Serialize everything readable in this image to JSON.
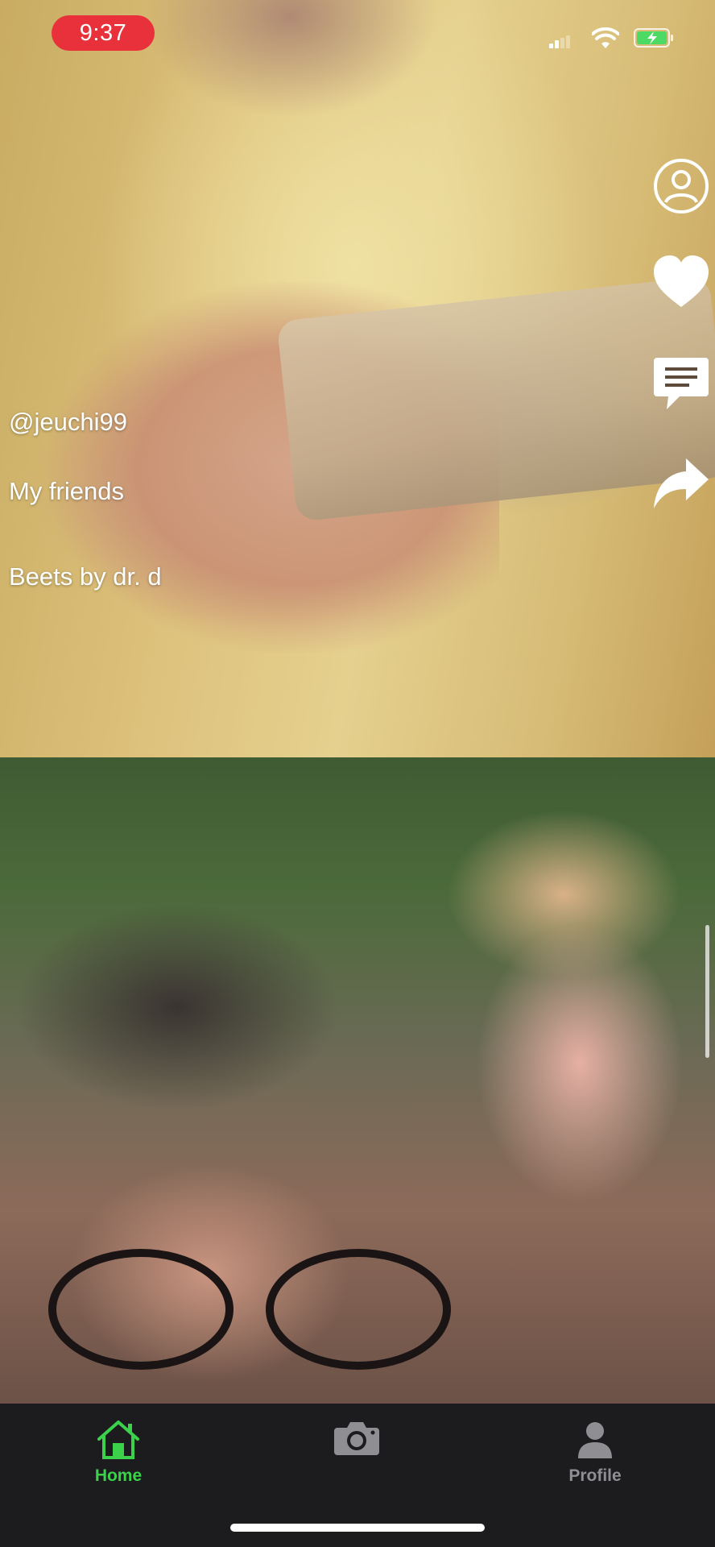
{
  "status_bar": {
    "time": "9:37",
    "icons": [
      "signal-icon",
      "wifi-icon",
      "battery-charging-icon"
    ],
    "time_badge_color": "#e8313b",
    "battery_color": "#4cd964"
  },
  "post": {
    "username": "@jeuchi99",
    "description": "My friends",
    "music": "Beets by dr. d"
  },
  "actions": {
    "icons": [
      "profile-icon",
      "heart-icon",
      "comment-icon",
      "share-icon"
    ]
  },
  "tab_bar": {
    "tabs": [
      {
        "label": "Home",
        "icon": "home-icon",
        "active": true
      },
      {
        "label": "",
        "icon": "camera-icon",
        "active": false
      },
      {
        "label": "Profile",
        "icon": "person-icon",
        "active": false
      }
    ],
    "active_color": "#3bd14b",
    "inactive_color": "#8e8e93"
  }
}
